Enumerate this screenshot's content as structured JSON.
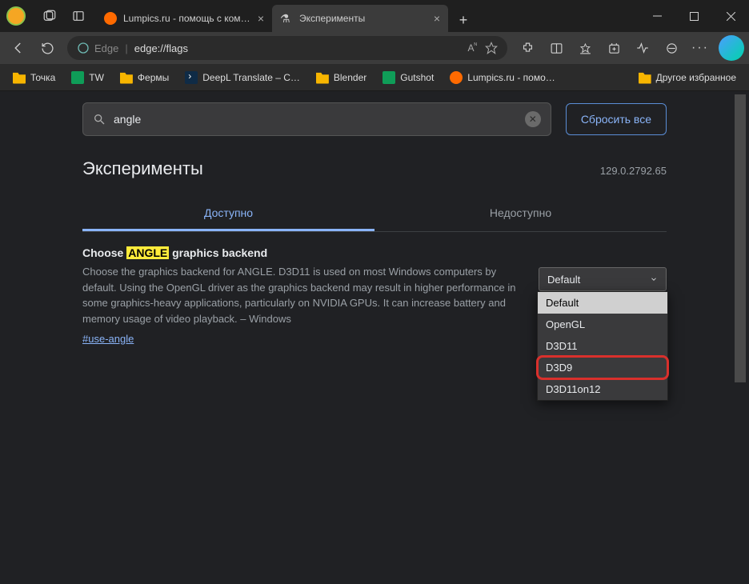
{
  "window": {
    "title": "Эксперименты"
  },
  "tabs": [
    {
      "label": "Lumpics.ru - помощь с компьют",
      "active": false
    },
    {
      "label": "Эксперименты",
      "active": true
    }
  ],
  "toolbar": {
    "edge_label": "Edge",
    "address": "edge://flags"
  },
  "bookmarks": {
    "items": [
      {
        "label": "Точка",
        "icon": "folder"
      },
      {
        "label": "TW",
        "icon": "sheets"
      },
      {
        "label": "Фермы",
        "icon": "folder"
      },
      {
        "label": "DeepL Translate – C…",
        "icon": "deepl"
      },
      {
        "label": "Blender",
        "icon": "folder"
      },
      {
        "label": "Gutshot",
        "icon": "sheets"
      },
      {
        "label": "Lumpics.ru - помо…",
        "icon": "orange"
      }
    ],
    "other_label": "Другое избранное"
  },
  "page": {
    "search_value": "angle",
    "reset_label": "Сбросить все",
    "heading": "Эксперименты",
    "version": "129.0.2792.65",
    "tab_available": "Доступно",
    "tab_unavailable": "Недоступно",
    "flag": {
      "title_pre": "Choose ",
      "title_hl": "ANGLE",
      "title_post": " graphics backend",
      "desc": "Choose the graphics backend for ANGLE. D3D11 is used on most Windows computers by default. Using the OpenGL driver as the graphics backend may result in higher performance in some graphics-heavy applications, particularly on NVIDIA GPUs. It can increase battery and memory usage of video playback. – Windows",
      "link": "#use-angle",
      "select_value": "Default",
      "options": [
        "Default",
        "OpenGL",
        "D3D11",
        "D3D9",
        "D3D11on12"
      ]
    }
  }
}
